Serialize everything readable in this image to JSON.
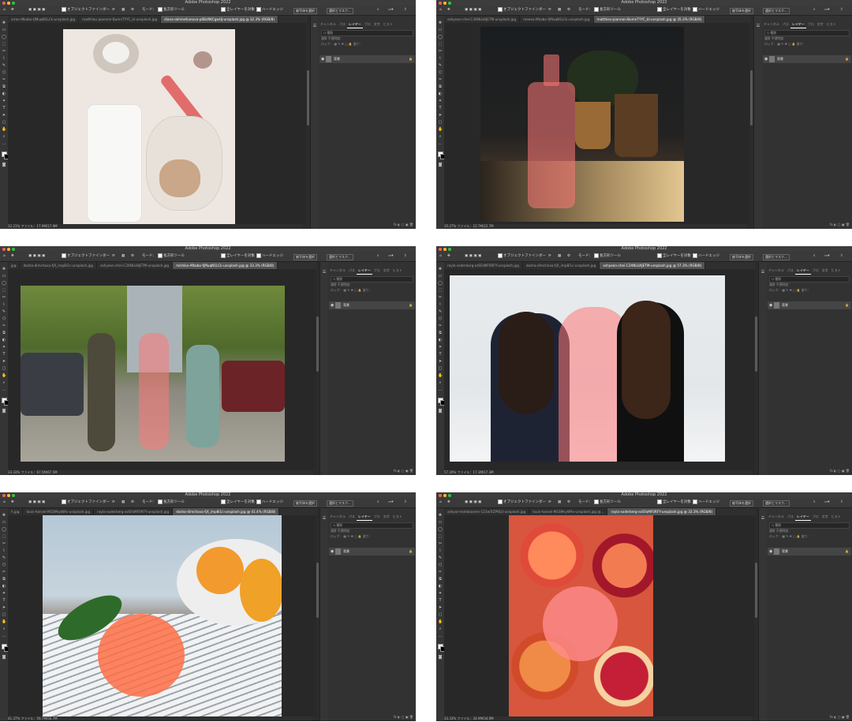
{
  "common": {
    "app_title": "Adobe Photoshop 2022",
    "opt_autoselect": "オブジェクトファインダー",
    "opt_mode": "モード：",
    "opt_tool": "長方形ツール",
    "opt_all_layers": "全レイヤーを対象",
    "opt_hard_edge": "ハードエッジ",
    "btn_select_subject": "被写体を選択",
    "btn_select_mask": "選択とマスク...",
    "search_label": "Q 種類",
    "row_normal": "通常",
    "row_opacity": "不透明度：",
    "row_lock": "ロック：",
    "row_fill": "塗り：",
    "panel_tabs": [
      "チャンネル",
      "パス",
      "レイヤー",
      "ブロ",
      "文字",
      "ヒスト"
    ],
    "layer_name": "背景",
    "panel_bottom": "fx ◐ ▢ ▣ 🗑",
    "colors": {
      "chrome": "#2b2b2b",
      "selection_overlay": "#ff7878"
    }
  },
  "windows": [
    {
      "tabs": [
        "airan-Afkabo-fjMuqN1LCk-unsplash.jpg",
        "matthieu-joannon-BumnTYYC_kl-unsplash.jpg",
        "diana-akhmetianova-p6BcNKCgwUJ-unsplash.jpg @ 32.3% (RGB/8)"
      ],
      "zoom": "32.21%",
      "file_info": "ファイル：17.9M/17.9M",
      "image_desc": "flat lay"
    },
    {
      "tabs": [
        "sahyeon-chei-C3XNLUAJETM-unsplash.jpg",
        "meesa-Afkabo-fjMuqN1LCk-unsplash.jpg",
        "matthieu-joannon-BumnTYYC_kl-unsplash.jpg @ 35.3% (RGB/8)"
      ],
      "zoom": "35.27%",
      "file_info": "ファイル：22.7M/22.7M",
      "image_desc": "sanitizer"
    },
    {
      "tabs": [
        "jpg",
        "dasha-dimchova-fjX_imp8i1c-unsplash.jpg",
        "sahyeon-chei-C3XNLUAJETM-unsplash.jpg",
        "mishiko-Afkabo-fjMuqN1LCk-unsplash.jpg @ 33.3% (RGB/8)"
      ],
      "zoom": "33.33%",
      "file_info": "ファイル：67.5M/67.5M",
      "image_desc": "street"
    },
    {
      "tabs": [
        "rayla-soderberg-ezSFaMF0RFY-unsplash.jpg",
        "dasha-dimchova-fjX_imp8i1c-unsplash.jpg",
        "sahyeon-chei-C3XNLUAJETM-unsplash.jpg @ 57.3% (RGB/8)"
      ],
      "zoom": "57.29%",
      "file_info": "ファイル：17.3M/17.3M",
      "image_desc": "women"
    },
    {
      "tabs": [
        "h.jpg",
        "louis-hansel-M1SMsyWAs-unsplash.jpg",
        "rayla-soderberg-ezSFaMF0RFY-unsplash.jpg",
        "dasha-dimchova-fjX_imp8i1c-unsplash.jpg @ 41.4% (RGB/8)"
      ],
      "zoom": "41.37%",
      "file_info": "ファイル：56.7M/56.7M",
      "image_desc": "tangerine"
    },
    {
      "tabs": [
        "ashyar-molebasenn-123wTrZPRLU-unsplash.jpg",
        "louis-hansel-M1SMsyWAs-unsplash.jpg @...",
        "rayla-soderberg-ezSFaMF0RFY-unsplash.jpg @ 33.3% (RGB/8)"
      ],
      "zoom": "33.33%",
      "file_info": "ファイル：34.9M/34.9M",
      "image_desc": "grapefruit"
    }
  ]
}
